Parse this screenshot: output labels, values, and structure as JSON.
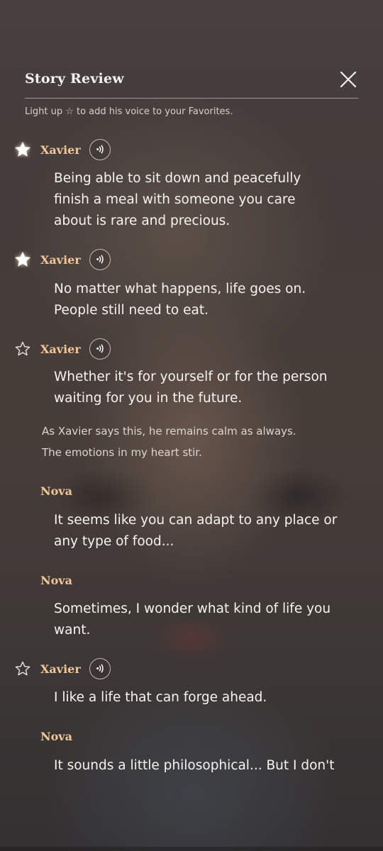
{
  "header": {
    "title": "Story Review",
    "close_icon": "close-icon"
  },
  "hint": "Light up ☆ to add his voice to your Favorites.",
  "colors": {
    "speaker": "#f1c79a",
    "text": "#f6f3f0",
    "narration": "#dcd6d1"
  },
  "entries": [
    {
      "speaker": "Xavier",
      "favorite": true,
      "voice_icon": "voice-play-icon",
      "line1": "Being able to sit down and peacefully",
      "line2": "finish a meal with someone you care",
      "line3": "about is rare and precious."
    },
    {
      "speaker": "Xavier",
      "favorite": true,
      "voice_icon": "voice-play-icon",
      "line1": "No matter what happens, life goes on.",
      "line2": "People still need to eat."
    },
    {
      "speaker": "Xavier",
      "favorite": false,
      "voice_icon": "voice-play-icon",
      "line1": "Whether it's for yourself or for the person",
      "line2": "waiting for you in the future."
    },
    {
      "narration1": "As Xavier says this, he remains calm as always.",
      "narration2": "The emotions in my heart stir."
    },
    {
      "speaker": "Nova",
      "line1": "It seems like you can adapt to any place or",
      "line2": "any type of food..."
    },
    {
      "speaker": "Nova",
      "line1": "Sometimes, I wonder what kind of life you",
      "line2": "want."
    },
    {
      "speaker": "Xavier",
      "favorite": false,
      "voice_icon": "voice-play-icon",
      "line1": "I like a life that can forge ahead."
    },
    {
      "speaker": "Nova",
      "line1": "It sounds a little philosophical... But I don't"
    }
  ]
}
